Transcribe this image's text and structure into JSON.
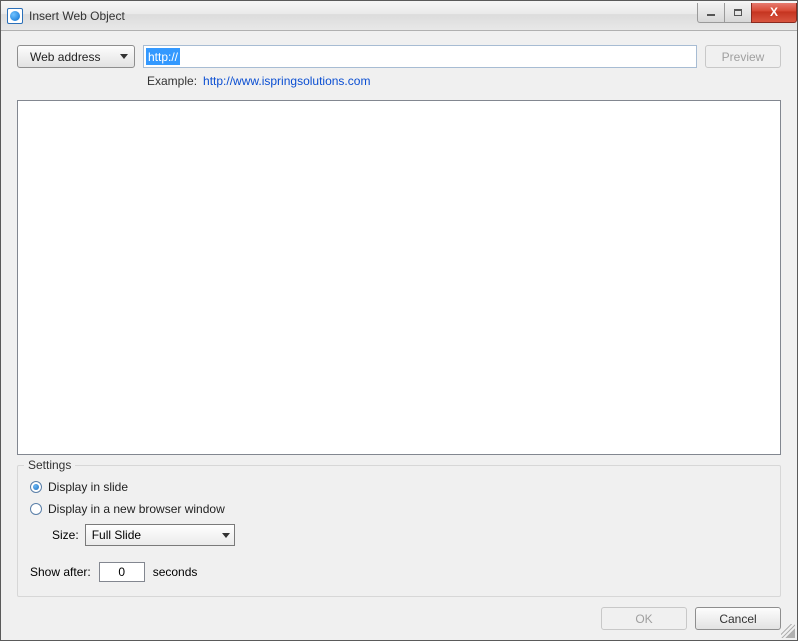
{
  "window": {
    "title": "Insert Web Object"
  },
  "toolbar": {
    "address_mode_label": "Web address",
    "url_value": "http://",
    "preview_label": "Preview",
    "example_label": "Example:",
    "example_url": "http://www.ispringsolutions.com"
  },
  "settings": {
    "legend": "Settings",
    "radio_display_in_slide": "Display in slide",
    "radio_display_new_window": "Display in a new browser window",
    "selected_radio": "in_slide",
    "size_label": "Size:",
    "size_value": "Full Slide",
    "show_after_label": "Show after:",
    "show_after_value": "0",
    "show_after_unit": "seconds"
  },
  "buttons": {
    "ok": "OK",
    "cancel": "Cancel"
  }
}
